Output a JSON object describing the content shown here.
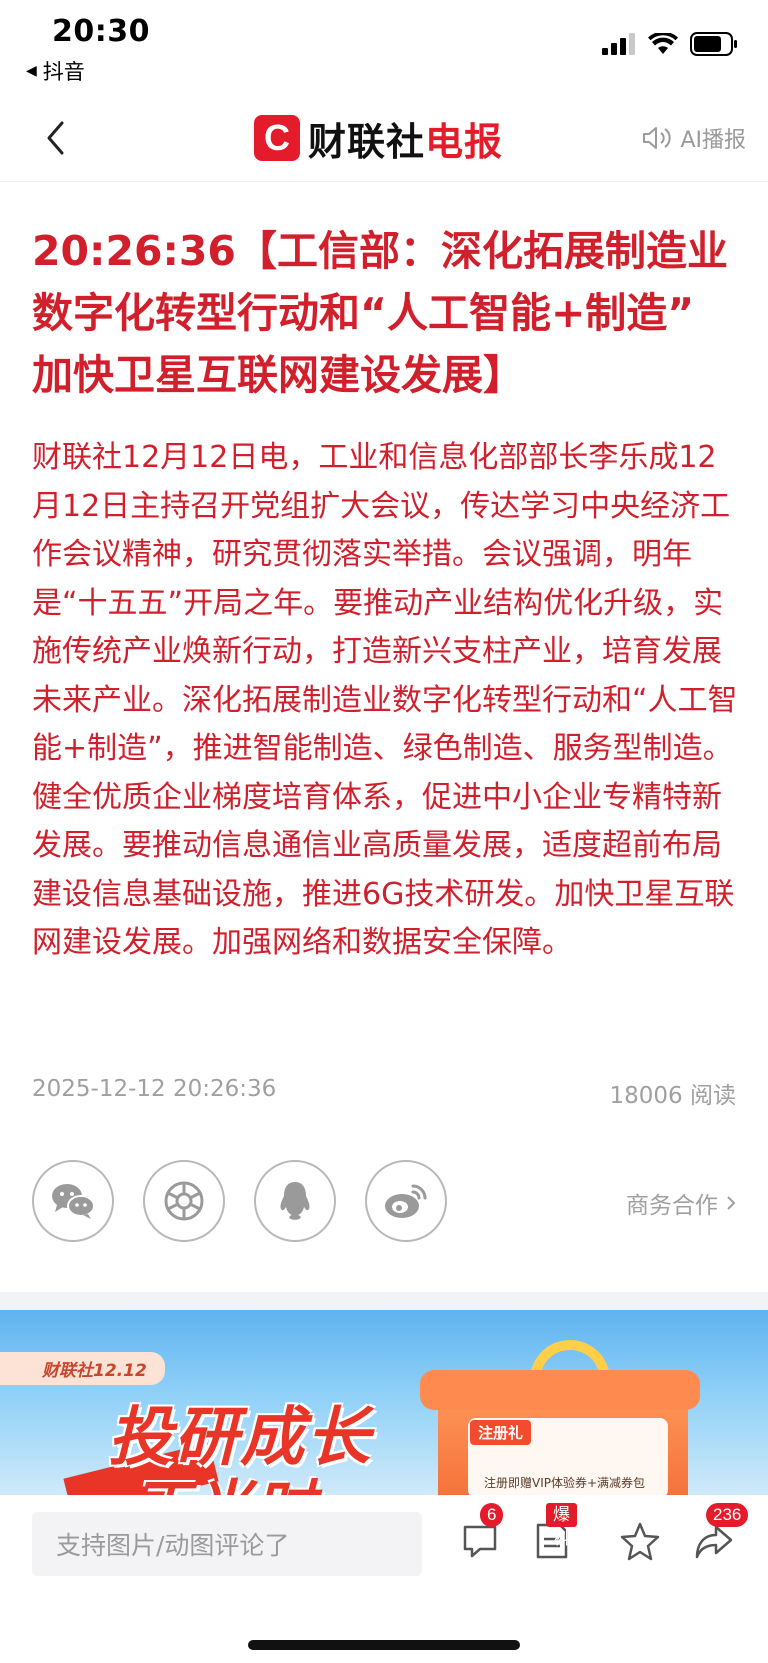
{
  "status_bar": {
    "time": "20:30",
    "back_app": "抖音"
  },
  "nav": {
    "brand_mark": "C",
    "brand_part1": "财联社",
    "brand_part2": "电报",
    "ai_play": "AI播报"
  },
  "article": {
    "headline": "20:26:36【工信部：深化拓展制造业数字化转型行动和“人工智能+制造” 加快卫星互联网建设发展】",
    "body": "财联社12月12日电，工业和信息化部部长李乐成12月12日主持召开党组扩大会议，传达学习中央经济工作会议精神，研究贯彻落实举措。会议强调，明年是“十五五”开局之年。要推动产业结构优化升级，实施传统产业焕新行动，打造新兴支柱产业，培育发展未来产业。深化拓展制造业数字化转型行动和“人工智能+制造”，推进智能制造、绿色制造、服务型制造。健全优质企业梯度培育体系，促进中小企业专精特新发展。要推动信息通信业高质量发展，适度超前布局建设信息基础设施，推进6G技术研发。加快卫星互联网建设发展。加强网络和数据安全保障。",
    "datetime": "2025-12-12 20:26:36",
    "reads": "18006 阅读"
  },
  "share": {
    "buttons": [
      {
        "icon": "wechat-icon"
      },
      {
        "icon": "moments-icon"
      },
      {
        "icon": "qq-icon"
      },
      {
        "icon": "weibo-icon"
      }
    ],
    "business_link": "商务合作"
  },
  "banner": {
    "tag": "财联社12.12",
    "slogan_line1": "投研成长",
    "slogan_line2": "正当时",
    "gift_chip": "注册礼",
    "gift_desc": "注册即赠VIP体验券+满减券包"
  },
  "bottom_bar": {
    "comment_placeholder": "支持图片/动图评论了",
    "comment_count": "6",
    "report_badge": "爆料",
    "share_count": "236"
  },
  "colors": {
    "accent_red": "#e31b2b",
    "article_red": "#d21f2c",
    "muted_gray": "#a0a0a0"
  }
}
